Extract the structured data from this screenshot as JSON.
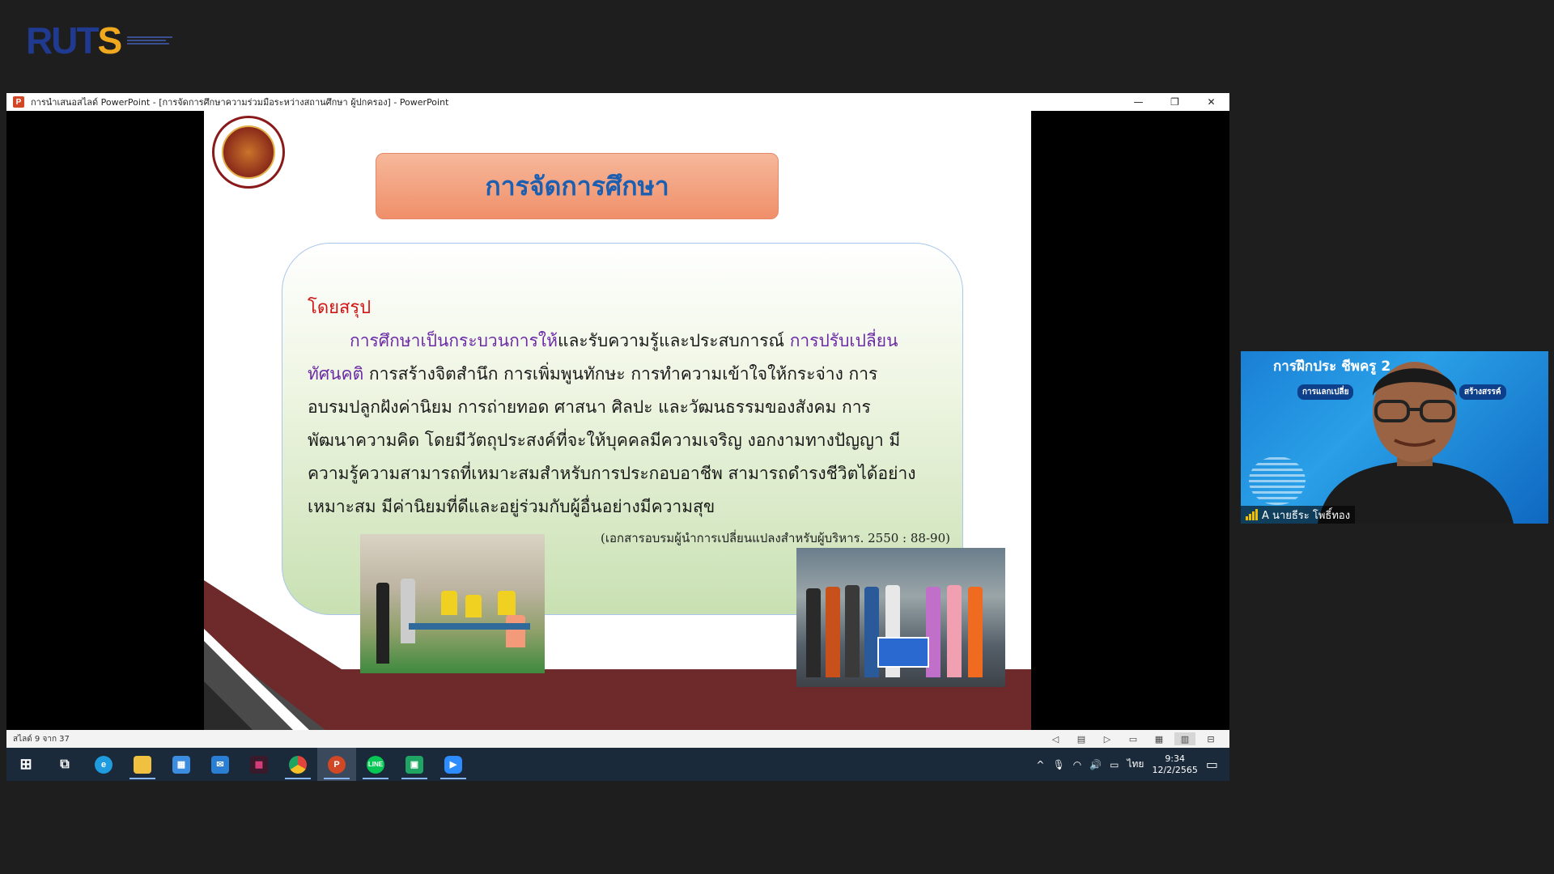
{
  "logo": {
    "part1": "RUT",
    "part2": "S"
  },
  "window": {
    "title": "การนำเสนอสไลด์ PowerPoint - [การจัดการศึกษาความร่วมมือระหว่างสถานศึกษา ผู้ปกครอง] - PowerPoint",
    "minimize": "—",
    "restore": "❐",
    "close": "✕"
  },
  "slide": {
    "title": "การจัดการศึกษา",
    "summary_label": "โดยสรุป",
    "lines": [
      {
        "highlight": "การศึกษาเป็นกระบวนการให้",
        "text": "และรับความรู้และประสบการณ์ ",
        "highlight2": "การปรับเปลี่ยน"
      },
      {
        "highlight": "ทัศนคติ",
        "text": " การสร้างจิตสำนึก การเพิ่มพูนทักษะ การทำความเข้าใจให้กระจ่าง การ"
      },
      {
        "text": "อบรมปลูกฝังค่านิยม การถ่ายทอด ศาสนา ศิลปะ และวัฒนธรรมของสังคม การ"
      },
      {
        "text": "พัฒนาความคิด โดยมีวัตถุประสงค์ที่จะให้บุคคลมีความเจริญ งอกงามทางปัญญา มี"
      },
      {
        "text": "ความรู้ความสามารถที่เหมาะสมสำหรับการประกอบอาชีพ สามารถดำรงชีวิตได้อย่าง"
      },
      {
        "text": "เหมาะสม มีค่านิยมที่ดีและอยู่ร่วมกับผู้อื่นอย่างมีความสุข"
      }
    ],
    "citation": "(เอกสารอบรมผู้นำการเปลี่ยนแปลงสำหรับผู้บริหาร. 2550 : 88-90)"
  },
  "status_bar": {
    "slide_counter": "สไลด์ 9 จาก 37",
    "view_icons": [
      "prev-icon",
      "notes-icon",
      "next-icon",
      "normal-view-icon",
      "sorter-view-icon",
      "reading-view-icon",
      "slideshow-icon"
    ]
  },
  "taskbar": {
    "apps": [
      {
        "name": "start-button",
        "glyph": "⊞",
        "color": "#ffffff"
      },
      {
        "name": "task-view-button",
        "glyph": "⧉",
        "color": "#ffffff"
      },
      {
        "name": "edge-icon",
        "glyph": "e",
        "color": "#1f9be0"
      },
      {
        "name": "file-explorer-icon",
        "glyph": "▭",
        "color": "#f0c040"
      },
      {
        "name": "store-icon",
        "glyph": "▦",
        "color": "#3c8ce0"
      },
      {
        "name": "mail-icon",
        "glyph": "✉",
        "color": "#2a7fd4"
      },
      {
        "name": "media-app-icon",
        "glyph": "▩",
        "color": "#c8306a"
      },
      {
        "name": "chrome-icon",
        "glyph": "◉",
        "color": "#e0443a"
      },
      {
        "name": "powerpoint-icon",
        "glyph": "P",
        "color": "#d24726"
      },
      {
        "name": "line-icon",
        "glyph": "L",
        "color": "#06c755"
      },
      {
        "name": "green-app-icon",
        "glyph": "▣",
        "color": "#1fa463"
      },
      {
        "name": "zoom-icon",
        "glyph": "▶",
        "color": "#2d8cff"
      }
    ],
    "language": "ไทย",
    "time": "9:34",
    "date": "12/2/2565"
  },
  "webcam": {
    "banner": "การฝึกประ          ชีพครู 2",
    "sub_left": "การแลกเปลี่ย",
    "sub_right": "สร้างสรรค์",
    "participant_name": "A นายธีระ โพธิ์ทอง"
  }
}
